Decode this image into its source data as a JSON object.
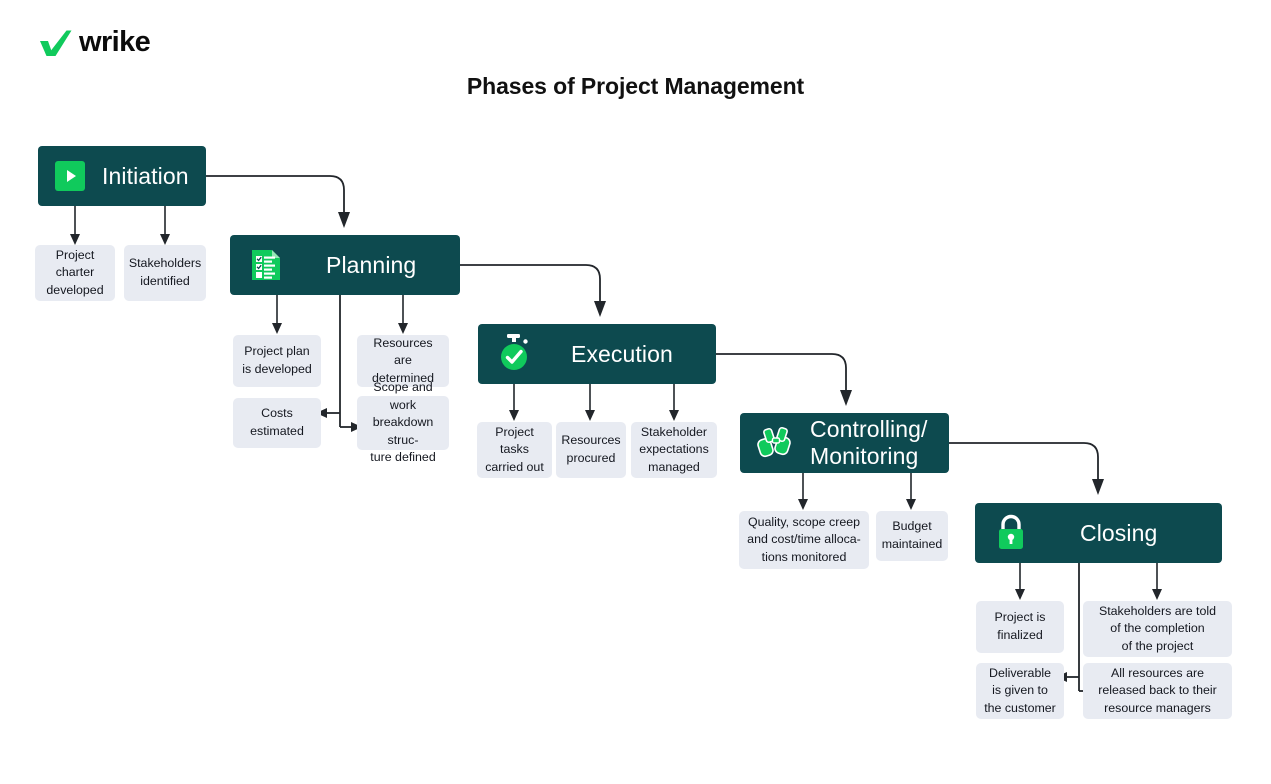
{
  "brand": {
    "logo_icon": "wrike-check-icon",
    "name": "wrike",
    "green": "#10ca5c",
    "dark_teal": "#0d4a4f",
    "sub_box_bg": "#e8ebf2",
    "line_color": "#22262b"
  },
  "header": {
    "title": "Phases of Project Management"
  },
  "phases": [
    {
      "id": "initiation",
      "label": "Initiation",
      "icon": "play-icon",
      "outputs": [
        {
          "id": "project-charter-developed",
          "text": "Project\ncharter\ndeveloped"
        },
        {
          "id": "stakeholders-identified",
          "text": "Stakeholders\nidentified"
        }
      ]
    },
    {
      "id": "planning",
      "label": "Planning",
      "icon": "checklist-document-icon",
      "outputs": [
        {
          "id": "project-plan-is-developed",
          "text": "Project plan\nis developed"
        },
        {
          "id": "resources-are-determined",
          "text": "Resources are\ndetermined"
        },
        {
          "id": "costs-estimated",
          "text": "Costs\nestimated"
        },
        {
          "id": "scope-and-work-breakdown-structure-defined",
          "text": "Scope and work\nbreakdown struc-\nture defined"
        }
      ]
    },
    {
      "id": "execution",
      "label": "Execution",
      "icon": "stopwatch-check-icon",
      "outputs": [
        {
          "id": "project-tasks-carried-out",
          "text": "Project\ntasks\ncarried out"
        },
        {
          "id": "resources-procured",
          "text": "Resources\nprocured"
        },
        {
          "id": "stakeholder-expectations-managed",
          "text": "Stakeholder\nexpectations\nmanaged"
        }
      ]
    },
    {
      "id": "controlling-monitoring",
      "label": "Controlling/\nMonitoring",
      "icon": "binoculars-icon",
      "outputs": [
        {
          "id": "quality-scope-creep-monitored",
          "text": "Quality, scope creep\nand cost/time alloca-\ntions monitored"
        },
        {
          "id": "budget-maintained",
          "text": "Budget\nmaintained"
        }
      ]
    },
    {
      "id": "closing",
      "label": "Closing",
      "icon": "padlock-icon",
      "outputs": [
        {
          "id": "project-is-finalized",
          "text": "Project is\nfinalized"
        },
        {
          "id": "stakeholders-are-told-of-completion",
          "text": "Stakeholders are told\nof the completion\nof the project"
        },
        {
          "id": "deliverable-is-given-to-the-customer",
          "text": "Deliverable\nis given to\nthe customer"
        },
        {
          "id": "all-resources-released-back",
          "text": "All resources are\nreleased back to their\nresource managers"
        }
      ]
    }
  ]
}
